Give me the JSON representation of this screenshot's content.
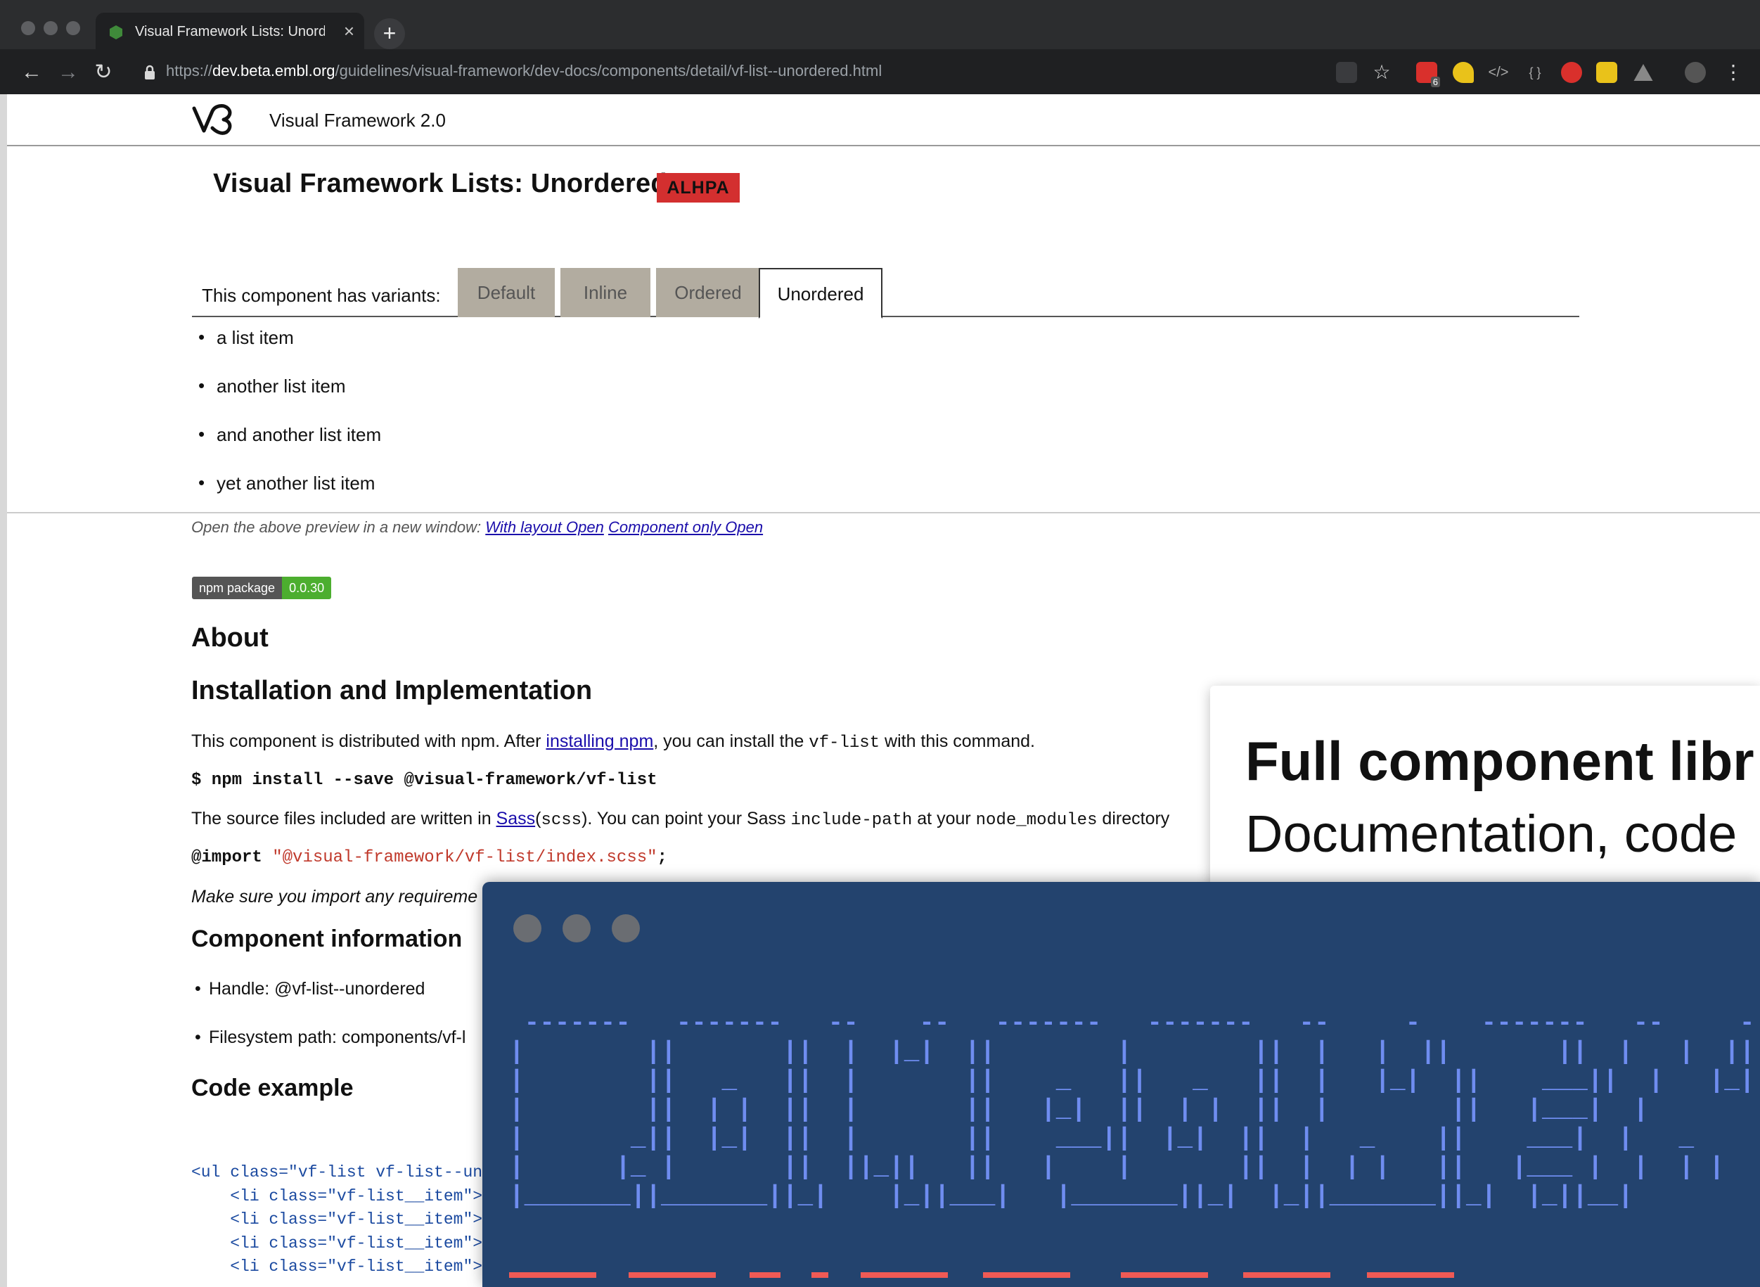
{
  "browser": {
    "tab_title": "Visual Framework Lists: Unordé",
    "url_scheme": "https://",
    "url_host": "dev.beta.embl.org",
    "url_path": "/guidelines/visual-framework/dev-docs/components/detail/vf-list--unordered.html",
    "extension_badge": "6"
  },
  "site": {
    "title": "Visual Framework 2.0"
  },
  "page": {
    "title": "Visual Framework Lists: Unordered",
    "status_badge": "ALHPA",
    "variants_label": "This component has variants:",
    "variants": [
      "Default",
      "Inline",
      "Ordered",
      "Unordered"
    ],
    "active_variant": "Unordered",
    "preview_items": [
      "a list item",
      "another list item",
      "and another list item",
      "yet another list item"
    ],
    "open_prefix": "Open the above preview in a new window:",
    "open_with_layout": "With layout Open",
    "open_component_only": "Component only Open",
    "npm_label": "npm package",
    "npm_version": "0.0.30",
    "about_heading": "About",
    "install_heading": "Installation and Implementation",
    "install_p1_a": "This component is distributed with npm. After ",
    "install_p1_link": "installing npm",
    "install_p1_b": ", you can install the ",
    "install_p1_code": "vf-list",
    "install_p1_c": " with this command.",
    "install_cmd": "$ npm install --save @visual-framework/vf-list",
    "install_p2_a": "The source files included are written in ",
    "install_p2_link": "Sass",
    "install_p2_b": "(",
    "install_p2_code1": "scss",
    "install_p2_c": "). You can point your Sass ",
    "install_p2_code2": "include-path",
    "install_p2_d": " at your ",
    "install_p2_code3": "node_modules",
    "install_p2_e": " directory",
    "import_keyword": "@import",
    "import_path": "\"@visual-framework/vf-list/index.scss\"",
    "import_end": ";",
    "requirements_note": "Make sure you import any requireme",
    "component_info_heading": "Component information",
    "handle": "Handle: @vf-list--unordered",
    "filesystem_path": "Filesystem path: components/vf-l",
    "code_example_heading": "Code example",
    "code_lines": [
      "<ul class=\"vf-list vf-list--unc",
      "    <li class=\"vf-list__item\">a",
      "    <li class=\"vf-list__item\">a",
      "    <li class=\"vf-list__item\">a",
      "    <li class=\"vf-list__item\">y"
    ]
  },
  "promo": {
    "title": "Full component libr",
    "subtitle": "Documentation, code"
  },
  "terminal": {
    "ascii_art": " -------   -------   --    --   -------   -------   --     -    -------   --     -   --\n|        ||       ||  |  |_|  ||        |        ||  |   |  ||       ||  |   |  ||  \n|        ||   _   ||  |       ||    _   ||   _   ||  |   |_|  ||    ___||  |   |_|  ||  \n|        ||  | |  ||  |       ||   |_|  ||  | |  ||  |        ||   |___|  |        ||  \n|       _||  |_|  ||  |       ||    ___||  |_|  ||  |   _    ||    ___|  |   _    ||  \n|      |_ |       ||  ||_||   ||   |    |       ||  |  | |   ||   |___ |  |  | |   ||  \n|_______||_______||_|    |_||___|   |_______||_|  |_||_______||_|  |_||__|"
  },
  "colors": {
    "badge_red": "#d32f2f",
    "variant_tab_bg": "#b2aca0",
    "link_blue": "#1a0dab",
    "npm_green": "#4cae2f",
    "terminal_bg": "#23436e",
    "ascii_blue": "#6f8df0",
    "ascii_red": "#ef5a55"
  },
  "icons": [
    "back-arrow-icon",
    "forward-arrow-icon",
    "reload-icon",
    "lock-icon",
    "star-icon",
    "menu-kebab-icon",
    "plus-icon",
    "close-icon",
    "vf-logo-icon"
  ]
}
